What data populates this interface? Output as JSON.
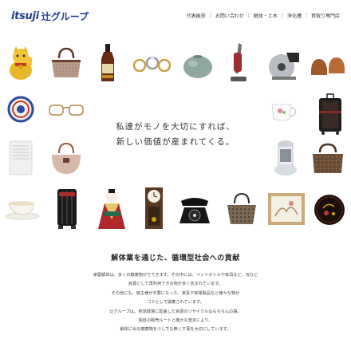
{
  "header": {
    "logo_mark": "itsuji",
    "logo_name": "辻グループ",
    "nav": [
      {
        "label": "代表挨拶"
      },
      {
        "label": "お問い合わせ"
      },
      {
        "label": "解体・土木"
      },
      {
        "label": "浄化槽"
      },
      {
        "label": "買取り専門店"
      }
    ]
  },
  "hero": {
    "tagline_line1": "私達がモノを大切にすれば、",
    "tagline_line2": "新しい価値が産まれてくる。",
    "item_icons": [
      "maneki-neko-icon",
      "handbag-icon",
      "liquor-bottle-icon",
      "rings-icon",
      "vase-icon",
      "vacuum-cleaner-icon",
      "circular-saw-icon",
      "loafers-icon",
      "decorative-plate-icon",
      "eyeglasses-icon",
      "teacup-icon",
      "suitcase-icon",
      "air-purifier-icon",
      "leather-bag-icon",
      "kerosene-heater-icon",
      "boston-bag-icon",
      "tea-cup-saucer-icon",
      "oil-heater-icon",
      "hina-doll-icon",
      "pendulum-clock-icon",
      "rotary-phone-icon",
      "tote-bag-icon",
      "framed-painting-icon",
      "lacquer-plate-icon"
    ]
  },
  "about": {
    "title": "解体業を通じた、循環型社会への貢献",
    "lines": [
      "家屋解体は、多くの廃棄物がでてきます。その中には、ペットボトルや家具など、瓦など",
      "資源として再利用できる物が多く含まれています。",
      "その他にも、施主様が不要になった、家具や家電製品など様々な物が",
      "ゴミとして破棄されています。",
      "辻グループは、地球環境に配慮した資源のリサイクルはもちろんの事。",
      "独自の販売ルートと確かな査定により、",
      "解体に出る廃棄物を少しでも無くす事を大切にしています。"
    ]
  },
  "colors": {
    "brand": "#1f3d8f",
    "text": "#333333",
    "background": "#ffffff"
  }
}
